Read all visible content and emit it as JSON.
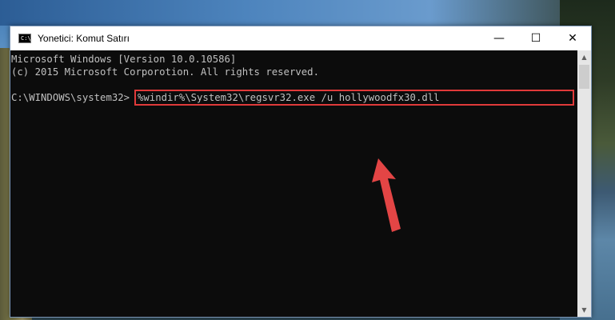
{
  "window": {
    "title": "Yonetici: Komut Satırı",
    "icon_text": "C:\\",
    "minimize_glyph": "—",
    "maximize_glyph": "☐",
    "close_glyph": "✕"
  },
  "console": {
    "lines": [
      "Microsoft Windows [Version 10.0.10586]",
      "(c) 2015 Microsoft Corporotion. All rights reserved."
    ],
    "prompt": "C:\\WINDOWS\\system32>",
    "command": "%windir%\\System32\\regsvr32.exe /u hollywoodfx30.dll"
  },
  "scrollbar": {
    "up_glyph": "▲",
    "down_glyph": "▼"
  },
  "colors": {
    "console_bg": "#0c0c0c",
    "console_text": "#c0c0c0",
    "highlight": "#e03a3a"
  },
  "icons": [
    "cmd-app-icon",
    "minimize-icon",
    "maximize-icon",
    "close-icon",
    "red-arrow-icon"
  ]
}
